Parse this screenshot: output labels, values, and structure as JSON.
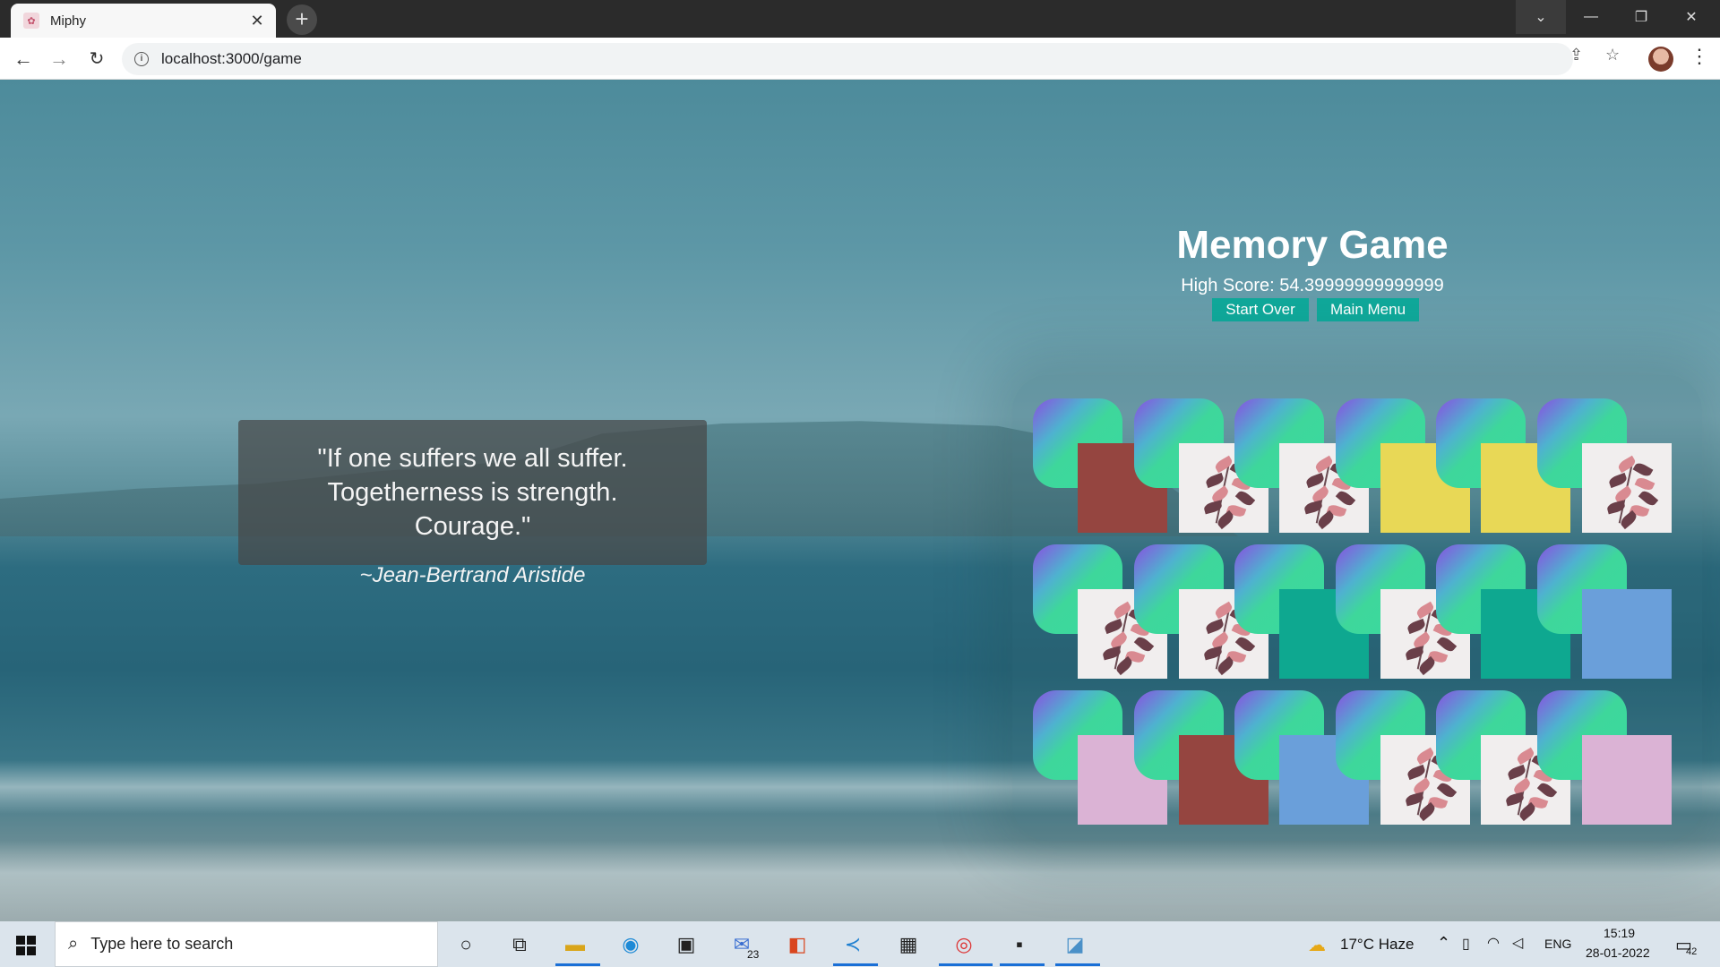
{
  "browser": {
    "tab_title": "Miphy",
    "tab_favicon": "✿",
    "close_glyph": "✕",
    "newtab_glyph": "+",
    "url": "localhost:3000/game",
    "window_controls": [
      "⌄",
      "—",
      "❐",
      "✕"
    ]
  },
  "quote": {
    "text": "\"If one suffers we all suffer. Togetherness is strength. Courage.\"",
    "author": "~Jean-Bertrand Aristide"
  },
  "game": {
    "title": "Memory Game",
    "high_score": "High Score: 54.39999999999999",
    "start_over_label": "Start Over",
    "main_menu_label": "Main Menu",
    "rows": [
      [
        "#954540",
        "flower",
        "flower",
        "#e8d856",
        "#e8d856",
        "flower"
      ],
      [
        "flower",
        "flower",
        "#0ea890",
        "flower",
        "#0ea890",
        "#6a9fda"
      ],
      [
        "#dbb3d5",
        "#954540",
        "#6a9fda",
        "flower",
        "flower",
        "#dbb3d5"
      ]
    ]
  },
  "taskbar": {
    "search_placeholder": "Type here to search",
    "weather": "17°C  Haze",
    "language": "ENG",
    "time": "15:19",
    "date": "28-01-2022",
    "notification_count": "42",
    "mail_badge": "23"
  }
}
